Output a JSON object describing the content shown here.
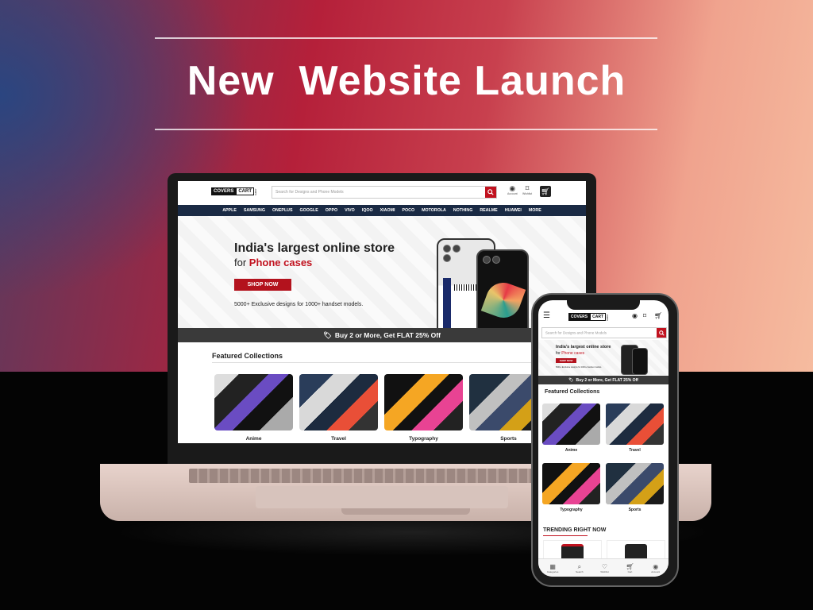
{
  "headline": "New  Website Launch",
  "colors": {
    "accent_red": "#c1121f",
    "nav_navy": "#1a2a44",
    "promo_gray": "#3a3a3a"
  },
  "site": {
    "logo": {
      "part1": "COVERS",
      "part2": "CART",
      "part3": ".com"
    },
    "search_placeholder": "Search for Designs and Phone Models",
    "account_label": "Account",
    "wishlist_label": "Wishlist",
    "nav_items": [
      "APPLE",
      "SAMSUNG",
      "ONEPLUS",
      "GOOGLE",
      "OPPO",
      "VIVO",
      "IQOO",
      "XIAOMI",
      "POCO",
      "MOTOROLA",
      "NOTHING",
      "REALME",
      "HUAWEI",
      "MORE"
    ],
    "hero": {
      "title": "India's largest online store",
      "sub_prefix": "for ",
      "sub_highlight": "Phone cases",
      "button": "SHOP NOW",
      "note": "5000+ Exclusive designs for 1000+ handset models."
    },
    "promo": "Buy 2 or More, Get FLAT 25% Off",
    "featured_title": "Featured Collections",
    "collections": [
      "Anime",
      "Travel",
      "Typography",
      "Sports"
    ],
    "trending_title": "TRENDING RIGHT NOW",
    "mobile_nav": [
      "Categories",
      "Search",
      "Wishlist",
      "Cart",
      "Account"
    ]
  }
}
